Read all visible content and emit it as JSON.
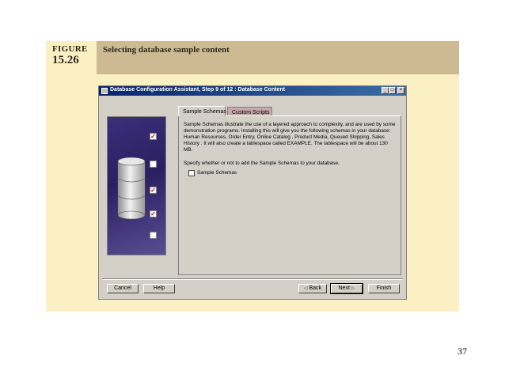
{
  "figure": {
    "label": "FIGURE",
    "number": "15.26",
    "caption": "Selecting database sample content"
  },
  "window": {
    "title": "Database Configuration Assistant, Step 9 of 12 : Database Content",
    "controls": {
      "minimize": "_",
      "maximize": "□",
      "close": "×"
    }
  },
  "tabs": [
    {
      "label": "Sample Schemas",
      "active": true
    },
    {
      "label": "Custom Scripts",
      "active": false
    }
  ],
  "content": {
    "description": "Sample Schemas illustrate the use of a layered approach to complexity, and are used by some demonstration programs. Installing this will give you the following schemas in your database: Human Resources, Order Entry, Online Catalog , Product Media, Queued Shipping, Sales History . It will also create a tablespace called EXAMPLE. The tablespace will be about 130 MB.",
    "prompt": "Specify whether or not to add the Sample Schemas to your database.",
    "checkbox_label": "Sample Schemas",
    "checkbox_checked": false
  },
  "art_checkboxes": [
    true,
    false,
    true,
    true,
    false
  ],
  "buttons": {
    "cancel": "Cancel",
    "help": "Help",
    "back": "Back",
    "next": "Next",
    "finish": "Finish"
  },
  "page_number": "37",
  "colors": {
    "figure_band": "#fbf0c4",
    "figure_header": "#cdb992",
    "titlebar": "#0a246a",
    "window_bg": "#d4d0c8"
  }
}
